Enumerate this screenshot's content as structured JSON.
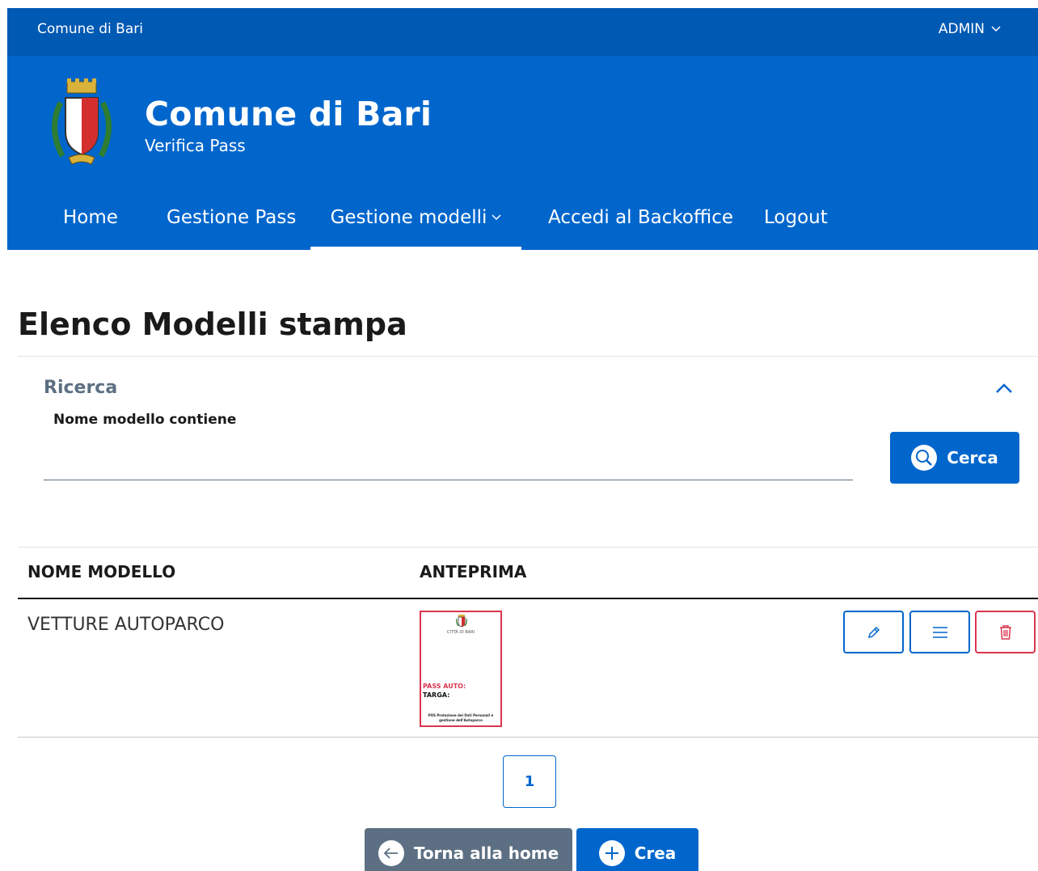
{
  "slim_header": {
    "org_name": "Comune di Bari",
    "user_label": "ADMIN"
  },
  "header": {
    "title": "Comune di Bari",
    "subtitle": "Verifica Pass"
  },
  "nav": {
    "items": [
      {
        "label": "Home"
      },
      {
        "label": "Gestione Pass"
      },
      {
        "label": "Gestione modelli",
        "active": true,
        "has_dropdown": true
      },
      {
        "label": "Accedi al Backoffice"
      },
      {
        "label": "Logout"
      }
    ]
  },
  "page": {
    "title": "Elenco Modelli stampa"
  },
  "search": {
    "title": "Ricerca",
    "field_label": "Nome modello contiene",
    "field_value": "",
    "button_label": "Cerca"
  },
  "table": {
    "headers": [
      "NOME MODELLO",
      "ANTEPRIMA"
    ],
    "rows": [
      {
        "name": "VETTURE AUTOPARCO",
        "preview": {
          "city_text": "CITTÀ DI BARI",
          "pass_text": "PASS AUTO:",
          "targa_text": "TARGA:",
          "footer_text": "POS Protezione dei Dati Personali e gestione dell'Autoparco"
        },
        "actions": [
          "pencil-icon",
          "list-icon",
          "trash-icon"
        ]
      }
    ]
  },
  "pagination": {
    "current": "1"
  },
  "footer_buttons": {
    "back_label": "Torna alla home",
    "create_label": "Crea"
  },
  "colors": {
    "primary": "#0066cc",
    "primary_dark": "#0059b3",
    "danger": "#d9364f",
    "secondary": "#5d7083"
  }
}
